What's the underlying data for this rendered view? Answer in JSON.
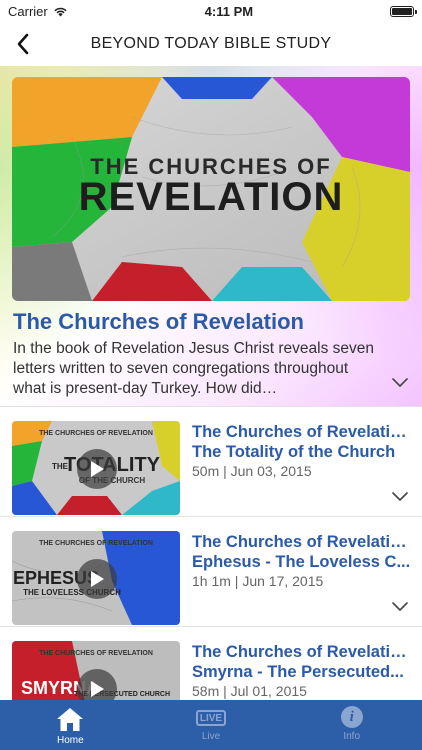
{
  "status_bar": {
    "carrier": "Carrier",
    "time": "4:11 PM"
  },
  "nav": {
    "title": "BEYOND TODAY BIBLE STUDY",
    "back_icon": "chevron-left-icon"
  },
  "hero": {
    "image_line1": "THE CHURCHES OF",
    "image_line2": "REVELATION",
    "title": "The Churches of Revelation",
    "description": "In the book of Revelation Jesus Christ reveals seven letters written to seven congregations throughout what is present-day Turkey. How did…"
  },
  "episodes": [
    {
      "title_line1": "The Churches of Revelation:",
      "title_line2": "The Totality of the Church",
      "meta": "50m | Jun 03, 2015",
      "thumb_caption": "THE CHURCHES OF REVELATION",
      "thumb_big": "TOTALITY",
      "thumb_small": "OF THE CHURCH",
      "thumb_prefix": "THE"
    },
    {
      "title_line1": "The Churches of Revelation:",
      "title_line2": "Ephesus - The Loveless C...",
      "meta": "1h 1m | Jun 17, 2015",
      "thumb_caption": "THE CHURCHES OF REVELATION",
      "thumb_big": "EPHESUS",
      "thumb_small": "THE LOVELESS CHURCH"
    },
    {
      "title_line1": "The Churches of Revelation:",
      "title_line2": "Smyrna - The Persecuted...",
      "meta": "58m | Jul 01, 2015",
      "thumb_caption": "THE CHURCHES OF REVELATION",
      "thumb_big": "SMYRNA",
      "thumb_small": "THE PERSECUTED CHURCH"
    }
  ],
  "tabs": [
    {
      "label": "Home",
      "icon": "home-icon",
      "active": true
    },
    {
      "label": "Live",
      "icon": "live-icon",
      "badge": "LIVE",
      "active": false
    },
    {
      "label": "Info",
      "icon": "info-icon",
      "glyph": "i",
      "active": false
    }
  ],
  "colors": {
    "accent": "#2b5aa8",
    "tab_bar": "#2d5fa9",
    "tab_inactive": "#8aa5cf"
  }
}
